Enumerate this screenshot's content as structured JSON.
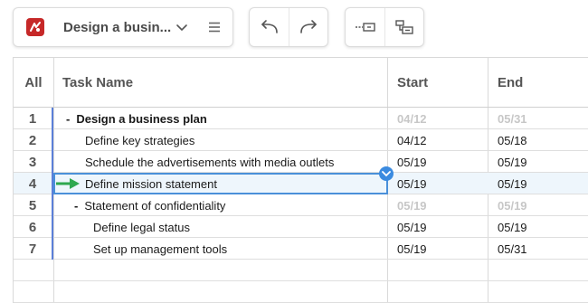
{
  "toolbar": {
    "project_title": "Design a busin...",
    "icons": [
      "app-logo-icon",
      "chevron-down-icon",
      "hamburger-menu-icon",
      "undo-icon",
      "redo-icon",
      "outdent-icon",
      "indent-icon"
    ]
  },
  "columns": {
    "row_header": "All",
    "task_name": "Task Name",
    "start": "Start",
    "end": "End"
  },
  "rows": [
    {
      "num": "1",
      "name": "Design a business plan",
      "start": "04/12",
      "end": "05/31"
    },
    {
      "num": "2",
      "name": "Define key strategies",
      "start": "04/12",
      "end": "05/18"
    },
    {
      "num": "3",
      "name": "Schedule the advertisements with media outlets",
      "start": "05/19",
      "end": "05/19"
    },
    {
      "num": "4",
      "name": "Define mission statement",
      "start": "05/19",
      "end": "05/19"
    },
    {
      "num": "5",
      "name": "Statement of confidentiality",
      "start": "05/19",
      "end": "05/19"
    },
    {
      "num": "6",
      "name": "Define legal status",
      "start": "05/19",
      "end": "05/19"
    },
    {
      "num": "7",
      "name": "Set up management tools",
      "start": "05/19",
      "end": "05/31"
    }
  ],
  "collapse_symbol": "-",
  "colors": {
    "accent": "#4a90d9",
    "logo": "#c62828",
    "arrow": "#2fa84f",
    "selected_row": "#eef6fc"
  }
}
